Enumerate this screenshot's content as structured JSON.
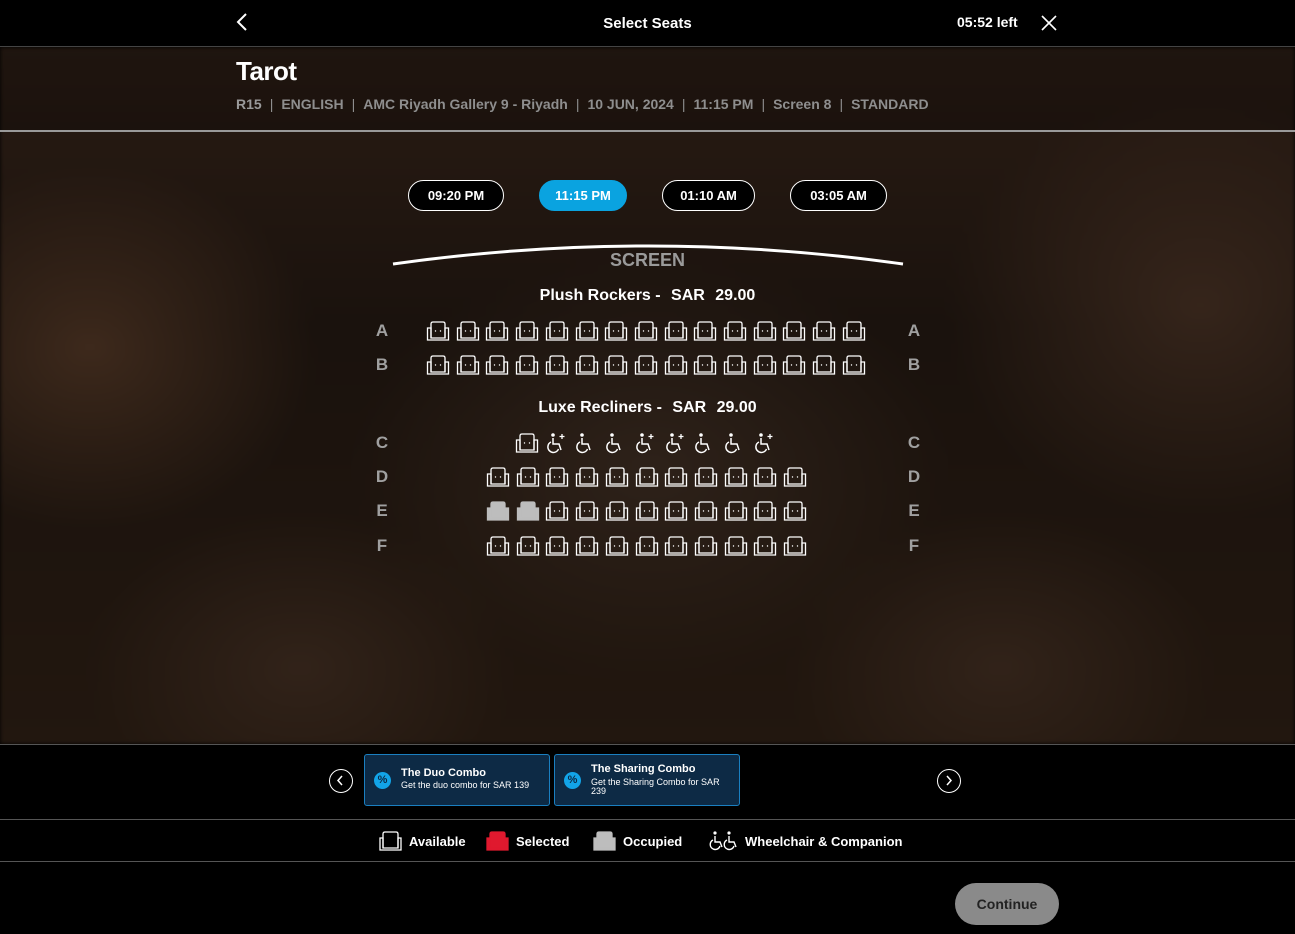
{
  "topbar": {
    "title": "Select Seats",
    "timer": "05:52 left"
  },
  "movie": {
    "title": "Tarot",
    "meta": [
      "R15",
      "ENGLISH",
      "AMC Riyadh Gallery 9 - Riyadh",
      "10 JUN, 2024",
      "11:15 PM",
      "Screen 8",
      "STANDARD"
    ]
  },
  "showtimes": [
    {
      "label": "09:20 PM",
      "active": false
    },
    {
      "label": "11:15 PM",
      "active": true
    },
    {
      "label": "01:10 AM",
      "active": false
    },
    {
      "label": "03:05 AM",
      "active": false
    }
  ],
  "screen_label": "SCREEN",
  "sections": [
    {
      "name": "Plush Rockers -",
      "currency": "SAR",
      "price": "29.00",
      "rows": [
        {
          "letter": "A",
          "seats": [
            "available",
            "available",
            "available",
            "available",
            "available",
            "available",
            "available",
            "available",
            "available",
            "available",
            "available",
            "available",
            "available",
            "available",
            "available"
          ]
        },
        {
          "letter": "B",
          "seats": [
            "available",
            "available",
            "available",
            "available",
            "available",
            "available",
            "available",
            "available",
            "available",
            "available",
            "available",
            "available",
            "available",
            "available",
            "available"
          ]
        }
      ]
    },
    {
      "name": "Luxe Recliners -",
      "currency": "SAR",
      "price": "29.00",
      "rows": [
        {
          "letter": "C",
          "seats": [
            "available",
            "companion",
            "wheelchair",
            "wheelchair",
            "companion",
            "companion",
            "wheelchair",
            "wheelchair",
            "companion"
          ]
        },
        {
          "letter": "D",
          "seats": [
            "available",
            "available",
            "available",
            "available",
            "available",
            "available",
            "available",
            "available",
            "available",
            "available",
            "available"
          ]
        },
        {
          "letter": "E",
          "seats": [
            "occupied",
            "occupied",
            "available",
            "available",
            "available",
            "available",
            "available",
            "available",
            "available",
            "available",
            "available"
          ]
        },
        {
          "letter": "F",
          "seats": [
            "available",
            "available",
            "available",
            "available",
            "available",
            "available",
            "available",
            "available",
            "available",
            "available",
            "available"
          ]
        }
      ]
    }
  ],
  "combos": [
    {
      "title": "The Duo Combo",
      "desc": "Get the duo combo for SAR 139",
      "icon": "%"
    },
    {
      "title": "The Sharing Combo",
      "desc": "Get the Sharing Combo for SAR 239",
      "icon": "%"
    }
  ],
  "legend": {
    "available": "Available",
    "selected": "Selected",
    "occupied": "Occupied",
    "wheelchair": "Wheelchair & Companion"
  },
  "colors": {
    "accent": "#0aa3e0",
    "selected": "#e0192e",
    "occupied": "#bdbdbd",
    "continue_disabled": "#8a8a8a"
  },
  "continue_label": "Continue"
}
